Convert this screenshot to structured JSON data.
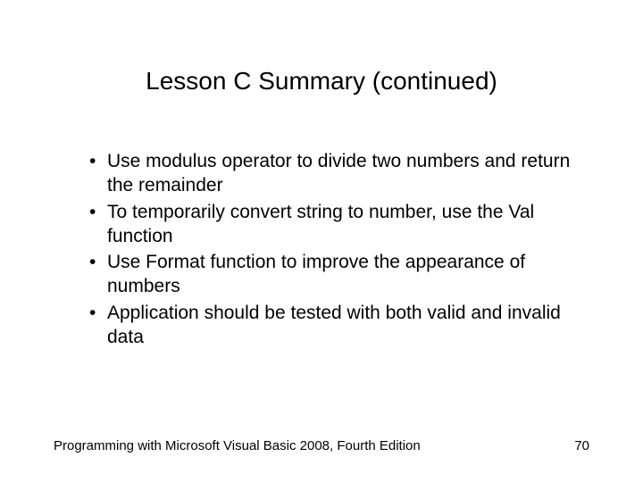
{
  "title": "Lesson C Summary (continued)",
  "bullets": [
    "Use modulus operator to divide two numbers and return the remainder",
    "To temporarily convert string to number, use the Val function",
    "Use Format function to improve the appearance of numbers",
    "Application should be tested with both valid and invalid data"
  ],
  "footer": {
    "text": "Programming with Microsoft Visual Basic 2008, Fourth Edition",
    "page": "70"
  }
}
